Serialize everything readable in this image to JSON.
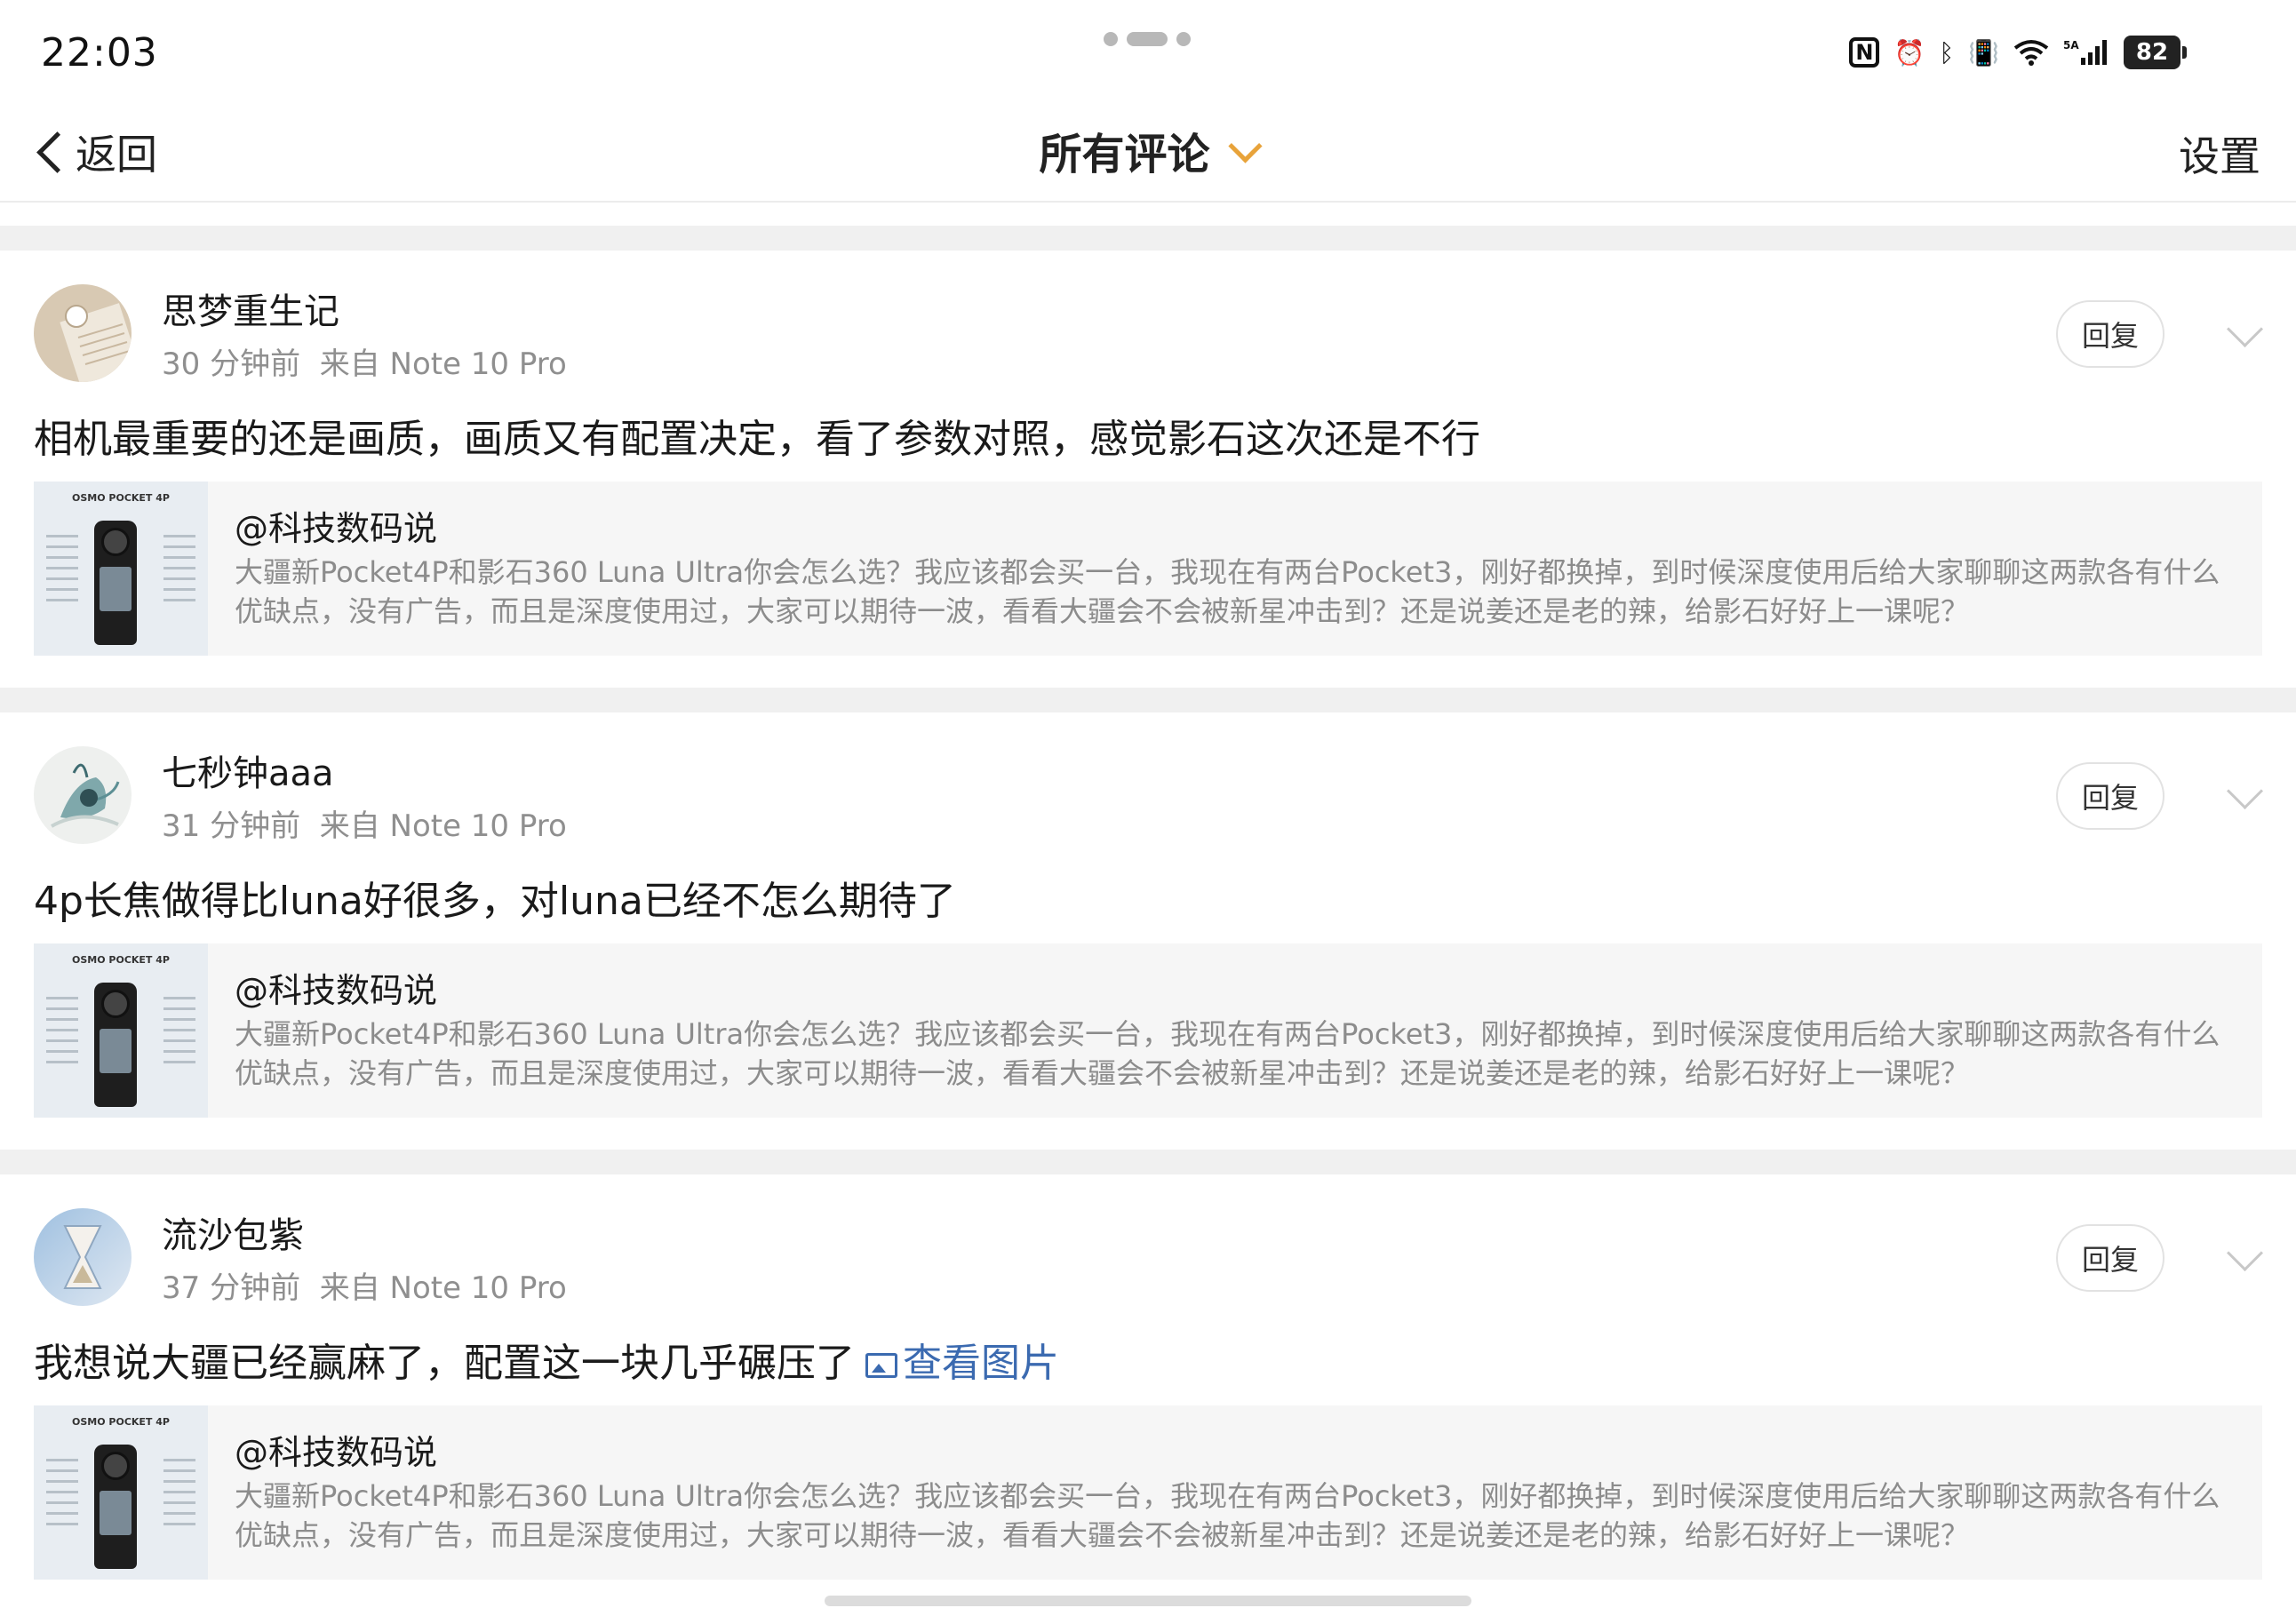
{
  "status_bar": {
    "time": "22:03",
    "icons": [
      "nfc-icon",
      "alarm-icon",
      "bluetooth-icon",
      "vibrate-icon",
      "wifi-icon",
      "signal-5a-icon"
    ],
    "battery": "82"
  },
  "nav": {
    "back_label": "返回",
    "title": "所有评论",
    "settings_label": "设置"
  },
  "comments": [
    {
      "username": "思梦重生记",
      "time": "30 分钟前",
      "source": "来自 Note 10 Pro",
      "reply_label": "回复",
      "text": "相机最重要的还是画质，画质又有配置决定，看了参数对照，感觉影石这次还是不行",
      "view_pic": "",
      "quote": {
        "thumb_title": "OSMO POCKET 4P",
        "author": "@科技数码说",
        "text": "大疆新Pocket4P和影石360 Luna Ultra你会怎么选？我应该都会买一台，我现在有两台Pocket3，刚好都换掉，到时候深度使用后给大家聊聊这两款各有什么优缺点，没有广告，而且是深度使用过，大家可以期待一波，看看大疆会不会被新星冲击到？还是说姜还是老的辣，给影石好好上一课呢？"
      }
    },
    {
      "username": "七秒钟aaa",
      "time": "31 分钟前",
      "source": "来自 Note 10 Pro",
      "reply_label": "回复",
      "text": "4p长焦做得比luna好很多，对luna已经不怎么期待了",
      "view_pic": "",
      "quote": {
        "thumb_title": "OSMO POCKET 4P",
        "author": "@科技数码说",
        "text": "大疆新Pocket4P和影石360 Luna Ultra你会怎么选？我应该都会买一台，我现在有两台Pocket3，刚好都换掉，到时候深度使用后给大家聊聊这两款各有什么优缺点，没有广告，而且是深度使用过，大家可以期待一波，看看大疆会不会被新星冲击到？还是说姜还是老的辣，给影石好好上一课呢？"
      }
    },
    {
      "username": "流沙包紫",
      "time": "37 分钟前",
      "source": "来自 Note 10 Pro",
      "reply_label": "回复",
      "text": "我想说大疆已经赢麻了，配置这一块几乎碾压了",
      "view_pic": "查看图片",
      "quote": {
        "thumb_title": "OSMO POCKET 4P",
        "author": "@科技数码说",
        "text": "大疆新Pocket4P和影石360 Luna Ultra你会怎么选？我应该都会买一台，我现在有两台Pocket3，刚好都换掉，到时候深度使用后给大家聊聊这两款各有什么优缺点，没有广告，而且是深度使用过，大家可以期待一波，看看大疆会不会被新星冲击到？还是说姜还是老的辣，给影石好好上一课呢？"
      }
    }
  ],
  "colors": {
    "accent_chevron": "#e8a33a",
    "link": "#3b6ab0",
    "meta_gray": "#8f8f8f",
    "divider": "#f0f0f0"
  }
}
